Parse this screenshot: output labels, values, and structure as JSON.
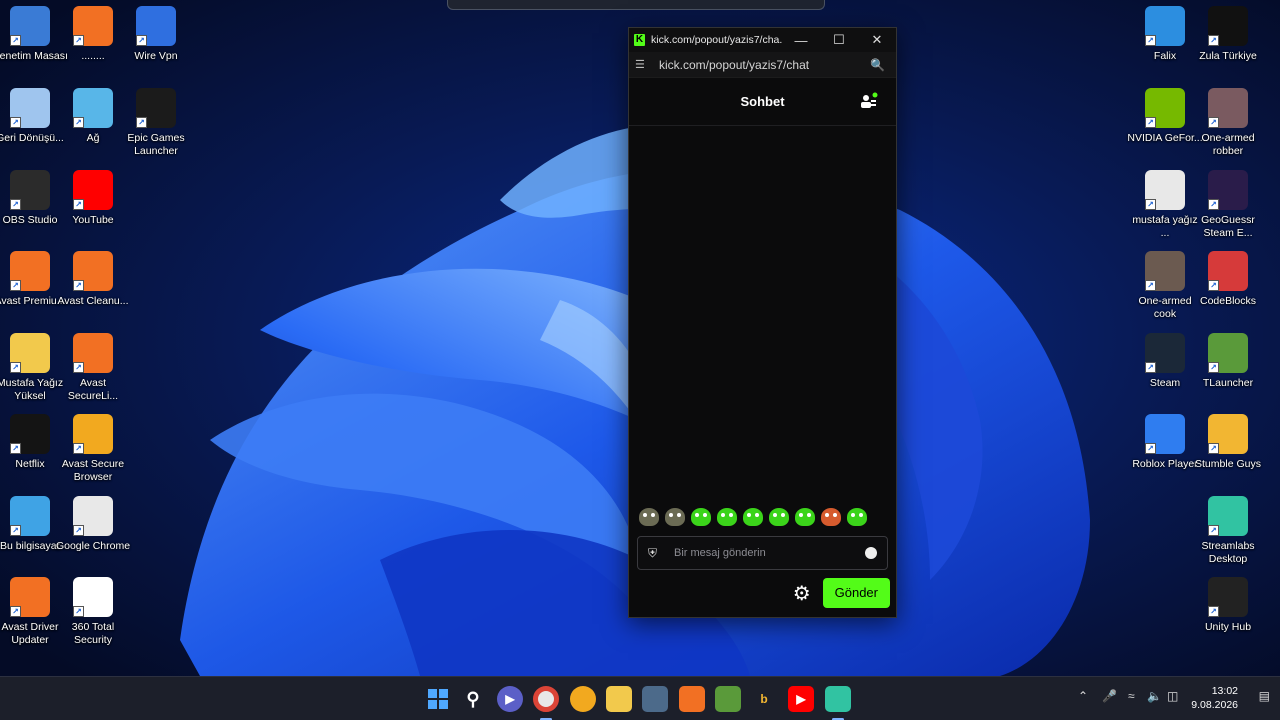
{
  "desktop": {
    "left_icons": [
      {
        "label": "Denetim Masası",
        "icon": "control-panel-icon",
        "color": "#3a7bd5"
      },
      {
        "label": "........",
        "icon": "avast-secureline-icon",
        "color": "#f27023"
      },
      {
        "label": "Wire Vpn",
        "icon": "vpn-rocket-icon",
        "color": "#2f6fe0"
      },
      {
        "label": "Geri Dönüşü...",
        "icon": "recycle-bin-icon",
        "color": "#9fc5ee"
      },
      {
        "label": "Ağ",
        "icon": "network-icon",
        "color": "#58b6e8"
      },
      {
        "label": "Epic Games Launcher",
        "icon": "epic-games-icon",
        "color": "#1b1b1b"
      },
      {
        "label": "OBS Studio",
        "icon": "obs-icon",
        "color": "#2b2b2b"
      },
      {
        "label": "YouTube",
        "icon": "youtube-icon",
        "color": "#ff0000"
      },
      {
        "label": "Avast Premiu...",
        "icon": "avast-icon",
        "color": "#f27023"
      },
      {
        "label": "Avast Cleanu...",
        "icon": "avast-cleanup-icon",
        "color": "#f27023"
      },
      {
        "label": "Mustafa Yağız Yüksel",
        "icon": "user-folder-icon",
        "color": "#f2c94c"
      },
      {
        "label": "Avast SecureLi...",
        "icon": "avast-secureline-icon",
        "color": "#f27023"
      },
      {
        "label": "Netflix",
        "icon": "netflix-icon",
        "color": "#141414"
      },
      {
        "label": "Avast Secure Browser",
        "icon": "avast-browser-icon",
        "color": "#f2a91f"
      },
      {
        "label": "Bu bilgisayar",
        "icon": "this-pc-icon",
        "color": "#3fa3e5"
      },
      {
        "label": "Google Chrome",
        "icon": "chrome-icon",
        "color": "#e8e8e8"
      },
      {
        "label": "Avast Driver Updater",
        "icon": "avast-driver-icon",
        "color": "#f27023"
      },
      {
        "label": "360 Total Security",
        "icon": "360-security-icon",
        "color": "#ffffff"
      }
    ],
    "right_icons": [
      {
        "label": "Falix",
        "icon": "falix-icon",
        "color": "#2c8ee0"
      },
      {
        "label": "Zula Türkiye",
        "icon": "zula-icon",
        "color": "#111111"
      },
      {
        "label": "NVIDIA GeFor...",
        "icon": "nvidia-icon",
        "color": "#76b900"
      },
      {
        "label": "One-armed robber",
        "icon": "one-armed-robber-icon",
        "color": "#7a5a60"
      },
      {
        "label": "mustafa yağız ...",
        "icon": "chrome-profile-icon",
        "color": "#e8e8e8"
      },
      {
        "label": "GeoGuessr Steam E...",
        "icon": "geoguessr-icon",
        "color": "#2a1c4a"
      },
      {
        "label": "One-armed cook",
        "icon": "one-armed-cook-icon",
        "color": "#6b5a50"
      },
      {
        "label": "CodeBlocks",
        "icon": "codeblocks-icon",
        "color": "#d63a3a"
      },
      {
        "label": "Steam",
        "icon": "steam-icon",
        "color": "#1b2838"
      },
      {
        "label": "TLauncher",
        "icon": "tlauncher-icon",
        "color": "#5a9a3a"
      },
      {
        "label": "Roblox Player",
        "icon": "roblox-icon",
        "color": "#2f7df0"
      },
      {
        "label": "Stumble Guys",
        "icon": "stumble-guys-icon",
        "color": "#f2b632"
      },
      {
        "label": "Streamlabs Desktop",
        "icon": "streamlabs-icon",
        "color": "#31c3a2"
      },
      {
        "label": "Unity Hub",
        "icon": "unity-icon",
        "color": "#222222"
      }
    ]
  },
  "popup": {
    "window_title": "kick.com/popout/yazis7/cha...",
    "url": "kick.com/popout/yazis7/chat",
    "chat_title": "Sohbet",
    "message_placeholder": "Bir mesaj gönderin",
    "send_label": "Gönder",
    "accent": "#53fc18"
  },
  "taskbar": {
    "time": "13:02",
    "date": "9.08.2026"
  }
}
